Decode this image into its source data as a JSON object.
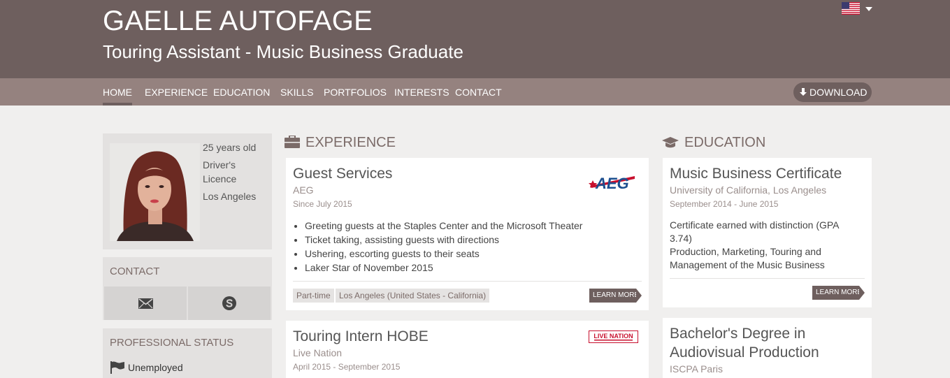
{
  "header": {
    "name": "GAELLE AUTOFAGE",
    "subtitle": "Touring Assistant - Music Business Graduate",
    "language_icon": "us-flag-icon"
  },
  "nav": {
    "items": [
      "HOME",
      "EXPERIENCE",
      "EDUCATION",
      "SKILLS",
      "PORTFOLIOS",
      "INTERESTS",
      "CONTACT"
    ],
    "active": "HOME",
    "download_label": "DOWNLOAD"
  },
  "profile": {
    "age": "25 years old",
    "licence_line1": "Driver's",
    "licence_line2": "Licence",
    "location": "Los Angeles"
  },
  "contact": {
    "title": "CONTACT",
    "icons": [
      "envelope-icon",
      "skype-icon"
    ]
  },
  "professional_status": {
    "title": "PROFESSIONAL STATUS",
    "value": "Unemployed"
  },
  "experience": {
    "title": "EXPERIENCE",
    "items": [
      {
        "title": "Guest Services",
        "company": "AEG",
        "date": "Since July 2015",
        "logo_text": "AEG",
        "bullets": [
          "Greeting guests at the Staples Center and the Microsoft Theater",
          "Ticket taking, assisting guests with directions",
          "Ushering, escorting guests to their seats",
          "Laker Star of November 2015"
        ],
        "tags": [
          "Part-time",
          "Los Angeles (United States - California)"
        ],
        "learn_more": "LEARN MORE"
      },
      {
        "title": "Touring Intern HOBE",
        "company": "Live Nation",
        "date": "April 2015 - September 2015",
        "logo_text": "LIVE NATION"
      }
    ]
  },
  "education": {
    "title": "EDUCATION",
    "items": [
      {
        "title": "Music Business Certificate",
        "school": "University of California, Los Angeles",
        "date": "September 2014 - June 2015",
        "description": "Certificate earned with distinction (GPA 3.74)\nProduction, Marketing, Touring and Management of the Music Business",
        "learn_more": "LEARN MORE"
      },
      {
        "title_line1": "Bachelor's Degree in",
        "title_line2": "Audiovisual Production",
        "school": "ISCPA Paris"
      }
    ]
  },
  "colors": {
    "header_bg": "#6e5f5e",
    "nav_bg": "#95827f",
    "page_bg": "#f0efee",
    "accent": "#7b6b68"
  }
}
